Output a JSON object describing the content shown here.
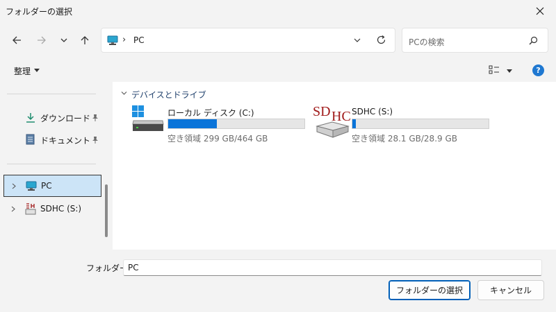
{
  "window": {
    "title": "フォルダーの選択"
  },
  "address": {
    "location": "PC",
    "separator": "›"
  },
  "search": {
    "placeholder": "PCの検索"
  },
  "toolbar": {
    "organize_label": "整理",
    "help_label": "?"
  },
  "sidebar": {
    "items": [
      {
        "label": "ダウンロード",
        "icon": "download-icon",
        "pinned": true
      },
      {
        "label": "ドキュメント",
        "icon": "document-icon",
        "pinned": true
      },
      {
        "label": "PC",
        "icon": "pc-icon",
        "selected": true
      },
      {
        "label": "SDHC (S:)",
        "icon": "sdhc-icon"
      }
    ]
  },
  "content": {
    "group_header": "デバイスとドライブ",
    "drives": [
      {
        "name": "ローカル ディスク (C:)",
        "free_text": "空き領域 299 GB/464 GB",
        "used_fraction": 0.356,
        "icon": "local-disk-icon"
      },
      {
        "name": "SDHC (S:)",
        "free_text": "空き領域 28.1 GB/28.9 GB",
        "used_fraction": 0.028,
        "icon": "sdhc-card-icon"
      }
    ]
  },
  "footer": {
    "folder_label": "フォルダー:",
    "folder_value": "PC",
    "select_button": "フォルダーの選択",
    "cancel_button": "キャンセル"
  },
  "colors": {
    "accent": "#0a74d9",
    "selection": "#cce4f7",
    "help": "#1f78d1"
  }
}
